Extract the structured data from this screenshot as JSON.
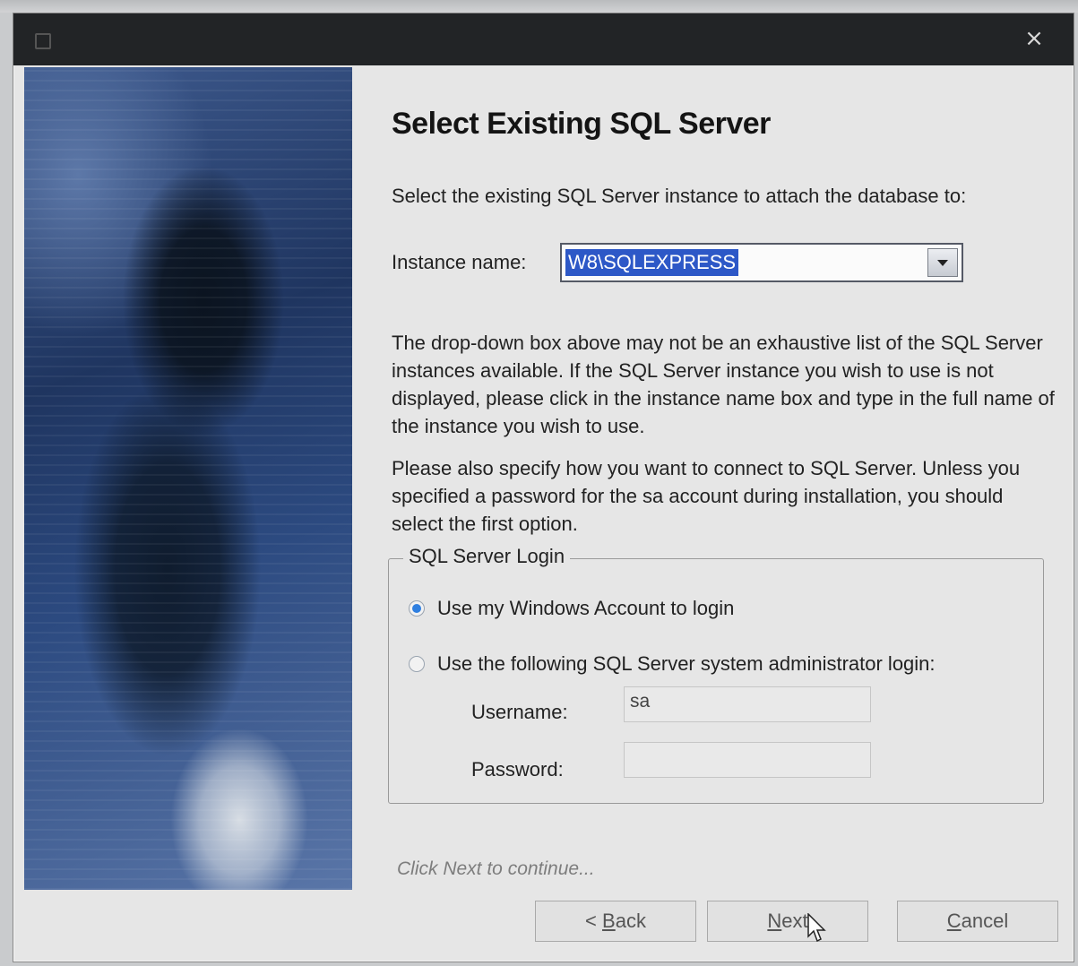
{
  "window": {
    "title": "",
    "close_icon": "×"
  },
  "heading": "Select Existing SQL Server",
  "intro_text": "Select the existing SQL Server instance to attach the database to:",
  "instance": {
    "label": "Instance name:",
    "value": "W8\\SQLEXPRESS"
  },
  "note_dropdown": "The drop-down box above may not be an exhaustive list of the SQL Server instances available. If the SQL Server instance you wish to use is not displayed, please click in the instance name box and type in the full name of the instance you wish to use.",
  "note_connect": "Please also specify how you want to connect to SQL Server. Unless you specified a password for the sa account during installation, you should select the first option.",
  "login": {
    "group_title": "SQL Server Login",
    "option_windows": "Use my Windows Account to login",
    "option_sql": "Use the following SQL Server system administrator login:",
    "selected": "windows",
    "username_label": "Username:",
    "username_value": "sa",
    "password_label": "Password:",
    "password_value": ""
  },
  "hint": "Click Next to continue...",
  "buttons": {
    "back_prefix": "< ",
    "back_mnemonic": "B",
    "back_rest": "ack",
    "next_mnemonic": "N",
    "next_rest": "ext",
    "cancel_mnemonic": "C",
    "cancel_rest": "ancel"
  }
}
